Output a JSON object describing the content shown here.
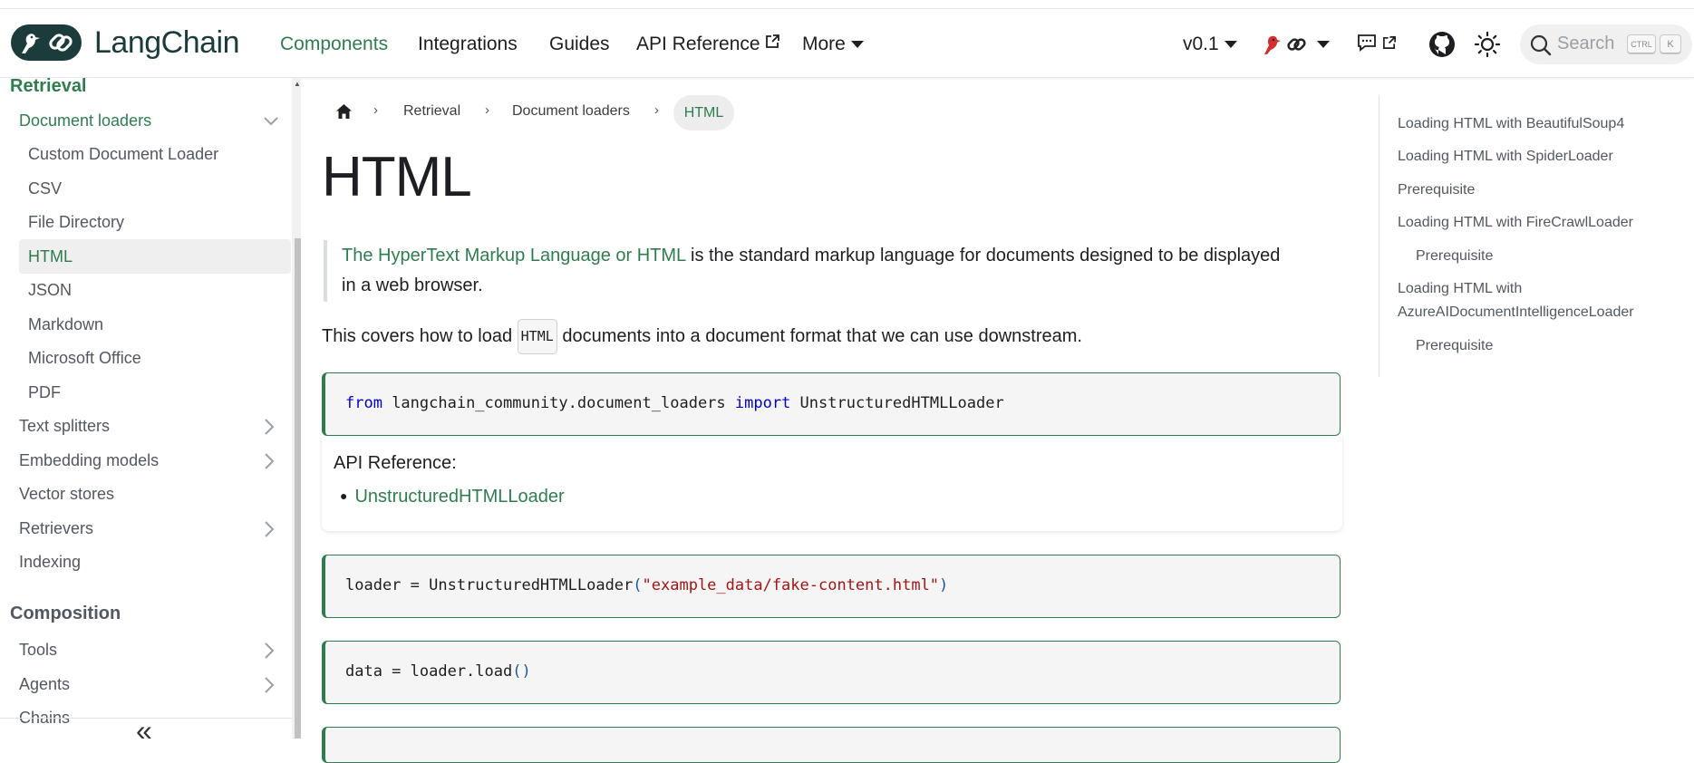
{
  "brand": {
    "name": "LangChain"
  },
  "nav": {
    "links": [
      "Components",
      "Integrations",
      "Guides",
      "API Reference",
      "More"
    ],
    "version": "v0.1",
    "search_placeholder": "Search",
    "kbd_ctrl": "CTRL",
    "kbd_k": "K"
  },
  "sidebar": {
    "section_retrieval": "Retrieval",
    "document_loaders": "Document loaders",
    "loaders": [
      "Custom Document Loader",
      "CSV",
      "File Directory",
      "HTML",
      "JSON",
      "Markdown",
      "Microsoft Office",
      "PDF"
    ],
    "items": [
      "Text splitters",
      "Embedding models",
      "Vector stores",
      "Retrievers",
      "Indexing"
    ],
    "section_composition": "Composition",
    "composition_items": [
      "Tools",
      "Agents",
      "Chains"
    ],
    "collapse_glyph": "«"
  },
  "breadcrumb": {
    "items": [
      "Retrieval",
      "Document loaders"
    ],
    "current": "HTML"
  },
  "page": {
    "title": "HTML",
    "quote_link": "The HyperText Markup Language or HTML",
    "quote_rest_1": " is the standard markup language for documents designed to be displayed",
    "quote_rest_2": "in a web browser.",
    "intro_before": "This covers how to load ",
    "intro_code": "HTML",
    "intro_after": " documents into a document format that we can use downstream.",
    "api_reference_label": "API Reference:",
    "api_reference_link": "UnstructuredHTMLLoader"
  },
  "code": {
    "block1": {
      "kw1": "from",
      "module": " langchain_community.document_loaders ",
      "kw2": "import",
      "name": " UnstructuredHTMLLoader"
    },
    "block2": {
      "pre": "loader = UnstructuredHTMLLoader",
      "open": "(",
      "arg": "\"example_data/fake-content.html\"",
      "close": ")"
    },
    "block3": {
      "pre": "data = loader.load",
      "parens": "()"
    }
  },
  "toc": {
    "items": [
      "Loading HTML with BeautifulSoup4",
      "Loading HTML with SpiderLoader",
      "Prerequisite",
      "Loading HTML with FireCrawlLoader",
      "Prerequisite",
      "Loading HTML with",
      "AzureAIDocumentIntelligenceLoader",
      "Prerequisite"
    ]
  },
  "colors": {
    "accent": "#2e7d4f",
    "brand_dark": "#1c3c3c",
    "text": "#1c1e21"
  }
}
